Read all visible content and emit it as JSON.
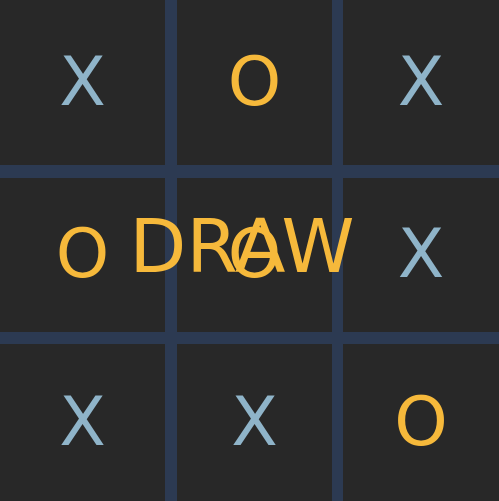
{
  "board": {
    "cells": [
      {
        "mark": "X",
        "player": "x"
      },
      {
        "mark": "O",
        "player": "o"
      },
      {
        "mark": "X",
        "player": "x"
      },
      {
        "mark": "O",
        "player": "o"
      },
      {
        "mark": "O",
        "player": "o"
      },
      {
        "mark": "X",
        "player": "x"
      },
      {
        "mark": "X",
        "player": "x"
      },
      {
        "mark": "X",
        "player": "x"
      },
      {
        "mark": "O",
        "player": "o"
      }
    ]
  },
  "result": {
    "label": "DRAW"
  },
  "colors": {
    "background": "#282828",
    "grid": "#2c3a52",
    "x_mark": "#8fb4c9",
    "o_mark": "#f6b93b",
    "banner": "#f6b93b"
  }
}
